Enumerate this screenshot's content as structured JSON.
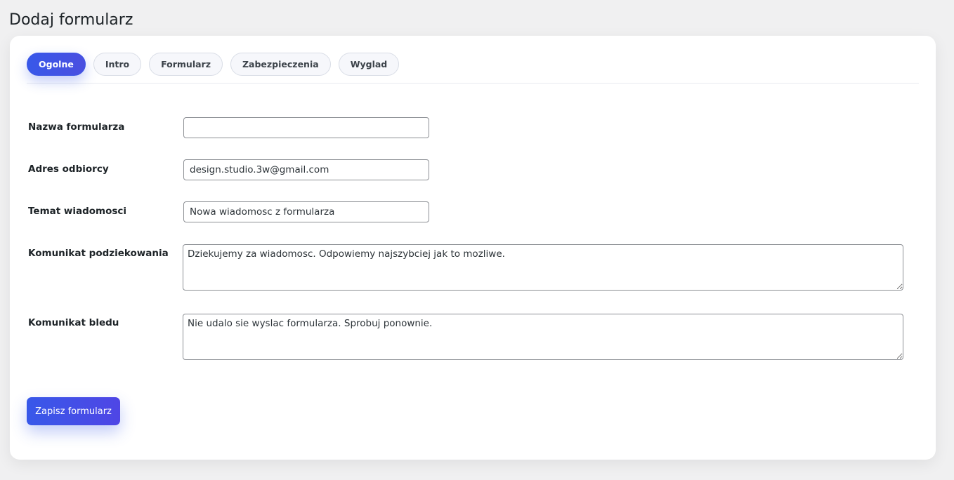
{
  "page": {
    "title": "Dodaj formularz"
  },
  "tabs": [
    {
      "label": "Ogolne",
      "active": true
    },
    {
      "label": "Intro",
      "active": false
    },
    {
      "label": "Formularz",
      "active": false
    },
    {
      "label": "Zabezpieczenia",
      "active": false
    },
    {
      "label": "Wyglad",
      "active": false
    }
  ],
  "form": {
    "form_name": {
      "label": "Nazwa formularza",
      "value": ""
    },
    "recipient": {
      "label": "Adres odbiorcy",
      "value": "design.studio.3w@gmail.com"
    },
    "subject": {
      "label": "Temat wiadomosci",
      "value": "Nowa wiadomosc z formularza"
    },
    "thanks_message": {
      "label": "Komunikat podziekowania",
      "value": "Dziekujemy za wiadomosc. Odpowiemy najszybciej jak to mozliwe."
    },
    "error_message": {
      "label": "Komunikat bledu",
      "value": "Nie udalo sie wyslac formularza. Sprobuj ponownie."
    }
  },
  "actions": {
    "save_label": "Zapisz formularz"
  },
  "colors": {
    "accent": "#3858e9",
    "background": "#f0f0f1",
    "card": "#ffffff"
  }
}
